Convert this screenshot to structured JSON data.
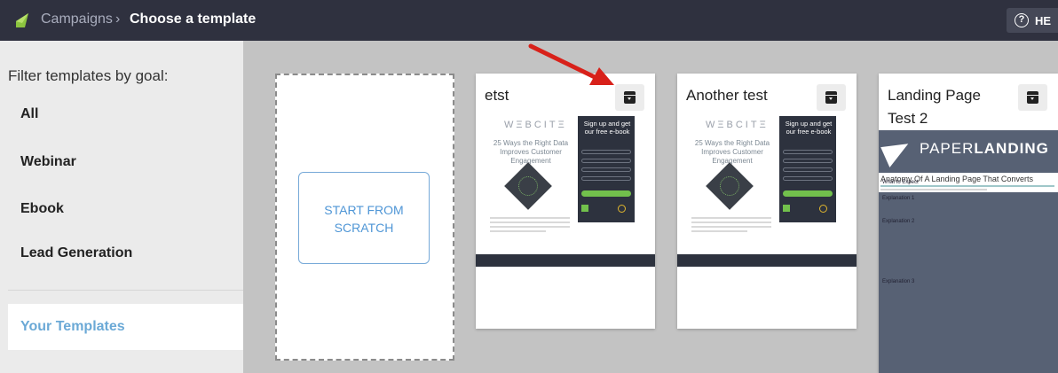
{
  "header": {
    "breadcrumb_link": "Campaigns",
    "breadcrumb_separator": "›",
    "breadcrumb_current": "Choose a template",
    "help_label": "HE",
    "help_icon": "?",
    "background": "#2f313f"
  },
  "sidebar": {
    "filter_title": "Filter templates by goal:",
    "goals": [
      "All",
      "Webinar",
      "Ebook",
      "Lead Generation"
    ],
    "your_templates": "Your Templates",
    "accent": "#6ba9d6"
  },
  "main": {
    "scratch_label": "START FROM SCRATCH",
    "templates": [
      {
        "title": "etst",
        "logo": "WΞBCITΞ",
        "headline": "25 Ways the Right Data Improves Customer Engagement",
        "signup_title": "Sign up and get our free e-book"
      },
      {
        "title": "Another test",
        "logo": "WΞBCITΞ",
        "headline": "25 Ways the Right Data Improves Customer Engagement",
        "signup_title": "Sign up and get our free e-book"
      },
      {
        "title": "Landing Page Test 2",
        "banner_light": "PAPER",
        "banner_bold": "LANDING",
        "subheadline": "Anatomy Of A Landing Page That Converts",
        "section_label": "What to Expect",
        "labels": [
          "Explanation 1",
          "Explanation 2",
          "Explanation 3"
        ]
      }
    ]
  },
  "icons": {
    "logo": "leaf-logo-icon",
    "help": "question-circle-icon",
    "archive": "archive-icon",
    "annotation": "red-arrow-annotation"
  }
}
